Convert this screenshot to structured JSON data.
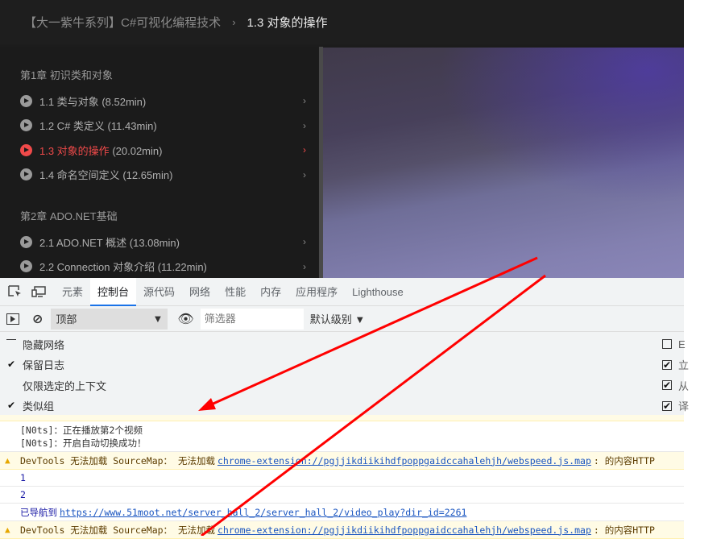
{
  "header": {
    "course": "【大一紫牛系列】C#可视化编程技术",
    "separator": "›",
    "current": "1.3 对象的操作"
  },
  "sidebar": {
    "chapters": [
      {
        "title": "第1章 初识类和对象",
        "lessons": [
          {
            "name": "1.1 类与对象",
            "duration": "(8.52min)",
            "active": false
          },
          {
            "name": "1.2 C# 类定义",
            "duration": "(11.43min)",
            "active": false
          },
          {
            "name": "1.3 对象的操作",
            "duration": "(20.02min)",
            "active": true
          },
          {
            "name": "1.4 命名空间定义",
            "duration": "(12.65min)",
            "active": false
          }
        ]
      },
      {
        "title": "第2章 ADO.NET基础",
        "lessons": [
          {
            "name": "2.1 ADO.NET 概述",
            "duration": "(13.08min)",
            "active": false
          },
          {
            "name": "2.2 Connection 对象介绍",
            "duration": "(11.22min)",
            "active": false
          }
        ]
      }
    ],
    "chevron": "›"
  },
  "devtools": {
    "tabs": [
      "元素",
      "控制台",
      "源代码",
      "网络",
      "性能",
      "内存",
      "应用程序",
      "Lighthouse"
    ],
    "active_tab": "控制台",
    "toolbar": {
      "context": "顶部",
      "filter_placeholder": "筛选器",
      "level": "默认级别 ▼"
    },
    "settings_left": [
      {
        "label": "隐藏网络",
        "checked": false
      },
      {
        "label": "保留日志",
        "checked": true
      },
      {
        "label": "仅限选定的上下文",
        "checked": false
      },
      {
        "label": "类似组",
        "checked": true
      }
    ],
    "settings_right": [
      {
        "label": "E",
        "checked": false
      },
      {
        "label": "立",
        "checked": true
      },
      {
        "label": "从",
        "checked": true
      },
      {
        "label": "译",
        "checked": true
      }
    ],
    "console": {
      "log1": "[N0ts]：正在播放第2个视频",
      "log2": "[N0ts]：开启自动切换成功！",
      "warn_prefix": "DevTools 无法加载 SourceMap： 无法加载",
      "warn_link": "chrome-extension://pgjjikdiikihdfpoppgaidccahalehjh/webspeed.js.map",
      "warn_suffix": ": 的内容HTTP",
      "val1": "1",
      "val2": "2",
      "nav_label": "已导航到",
      "nav_link": "https://www.51moot.net/server_hall_2/server_hall_2/video_play?dir_id=2261"
    }
  },
  "colors": {
    "accent": "#f04a4a",
    "annotation": "#ff0000"
  }
}
